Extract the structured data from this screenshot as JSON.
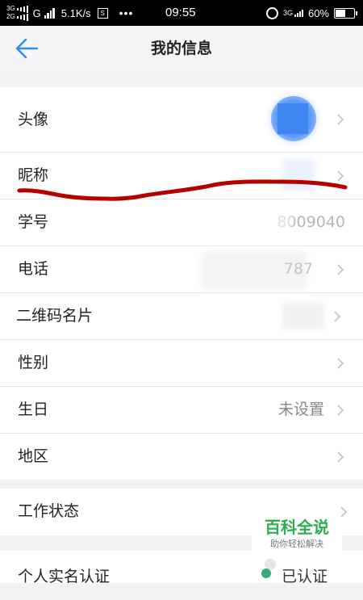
{
  "status_bar": {
    "sig1": "3G",
    "sig2": "2G",
    "carrier_g": "G",
    "speed": "5.1K/s",
    "box_icon": "S",
    "dots": "•••",
    "time": "09:55",
    "net": "3G",
    "battery": "60%",
    "battery_level": 0.6
  },
  "header": {
    "title": "我的信息",
    "back_icon": "back-arrow-icon",
    "accent_color": "#2b8ff2"
  },
  "rows": [
    {
      "label": "头像",
      "value": ""
    },
    {
      "label": "昵称",
      "value": ""
    },
    {
      "label": "学号",
      "value": "8009040"
    },
    {
      "label": "电话",
      "value": "787"
    },
    {
      "label": "二维码名片",
      "value": ""
    },
    {
      "label": "性别",
      "value": ""
    },
    {
      "label": "生日",
      "value": "未设置"
    },
    {
      "label": "地区",
      "value": ""
    }
  ],
  "group2": {
    "work_status": "工作状态"
  },
  "group3": {
    "realname": "个人实名认证",
    "realname_value": "已认证"
  },
  "watermark": {
    "title": "百科全说",
    "subtitle": "助你轻松解决"
  },
  "annotation_color": "#b50000"
}
